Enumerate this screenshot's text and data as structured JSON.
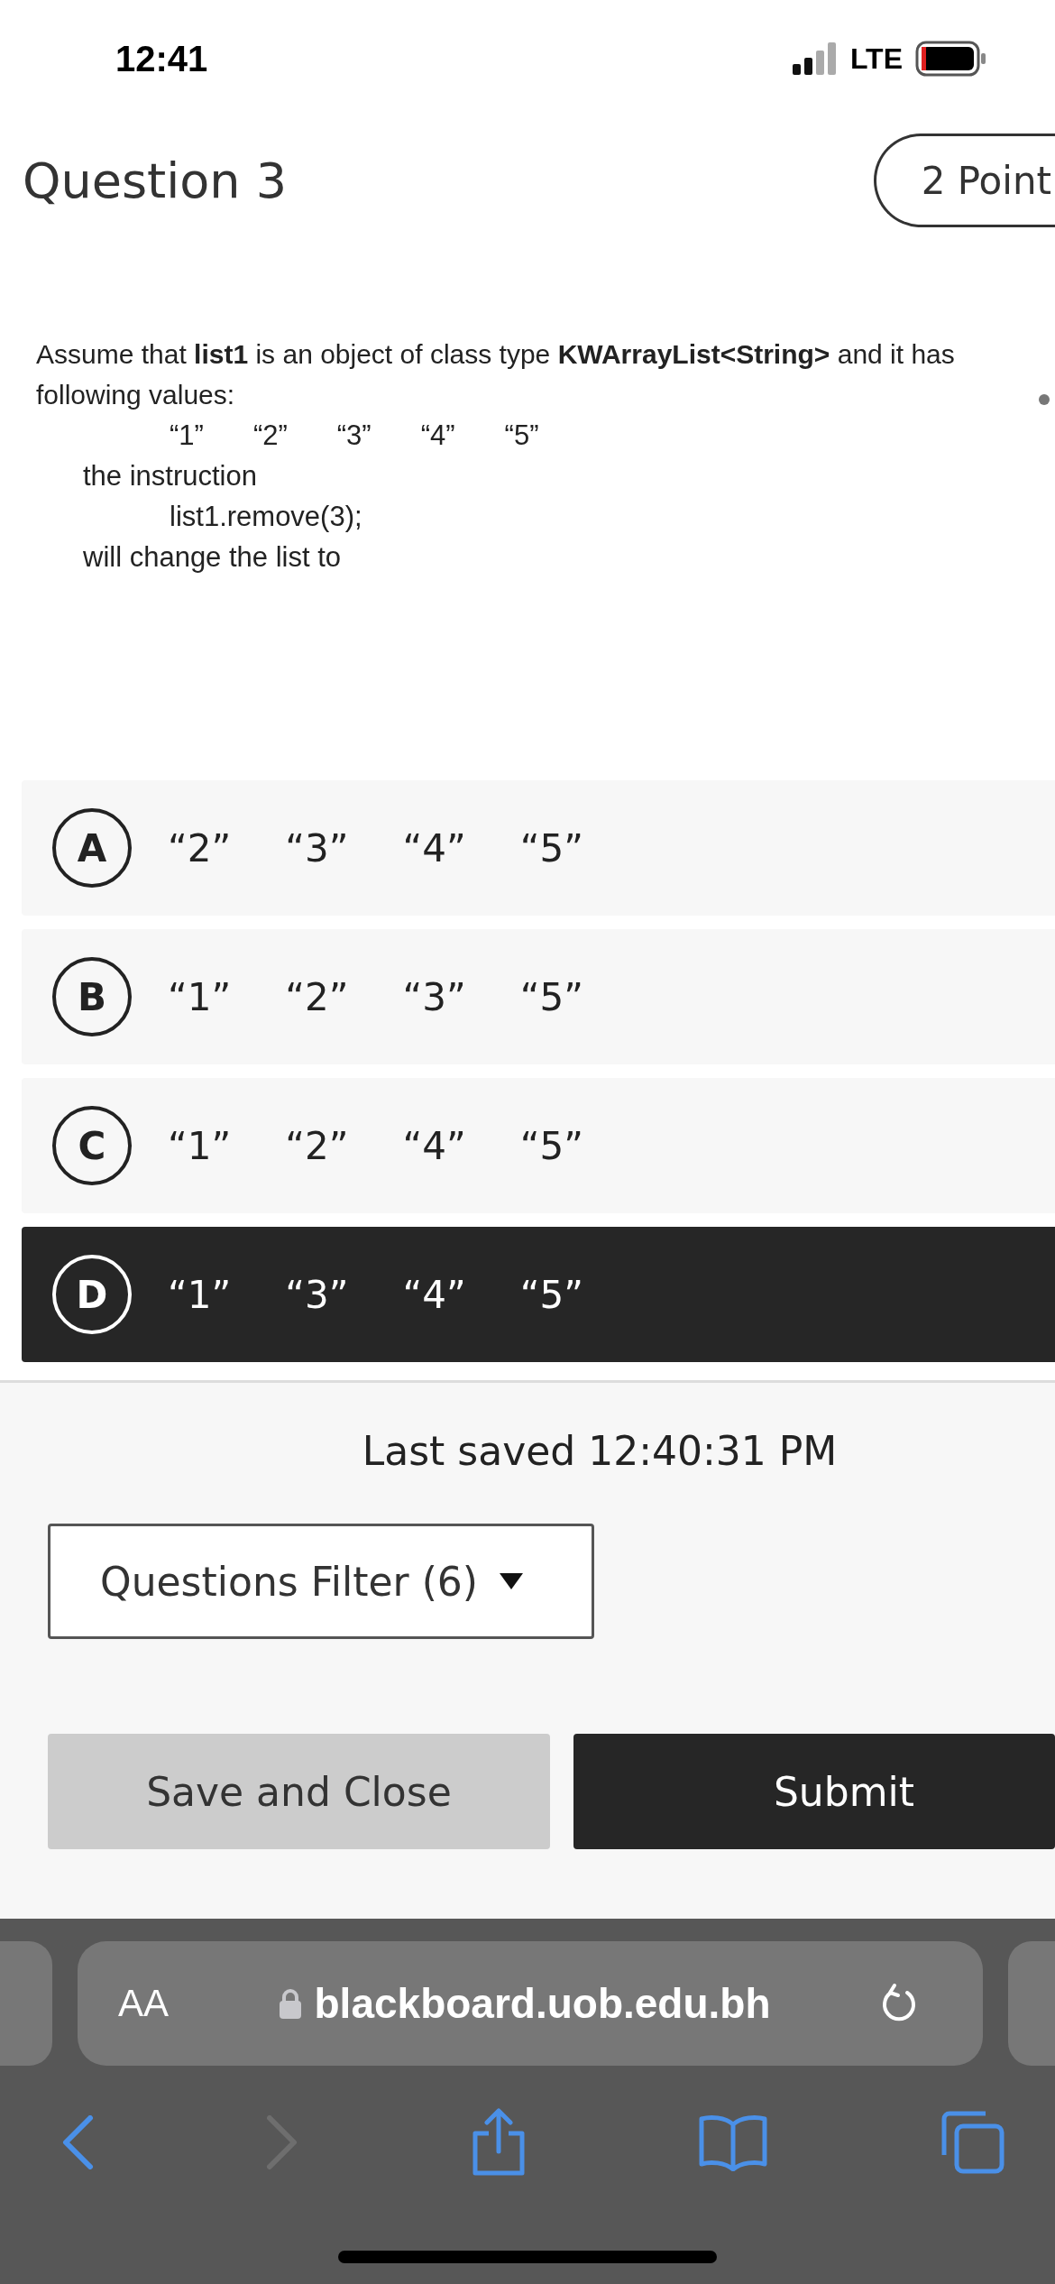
{
  "status_bar": {
    "time": "12:41",
    "network": "LTE"
  },
  "question": {
    "title": "Question 3",
    "points": "2 Point"
  },
  "prompt": {
    "intro": "Assume that **list1** is an object of class type **KWArrayList<String>** and it has\nfollowing values:",
    "values": [
      "“1”",
      "“2”",
      "“3”",
      "“4”",
      "“5”"
    ],
    "line_1": "the instruction",
    "code": "list1.remove(3);",
    "line_2": "will change the list to"
  },
  "options": [
    {
      "letter": "A",
      "values": [
        "“2”",
        "“3”",
        "“4”",
        "“5”"
      ],
      "selected": false
    },
    {
      "letter": "B",
      "values": [
        "“1”",
        "“2”",
        "“3”",
        "“5”"
      ],
      "selected": false
    },
    {
      "letter": "C",
      "values": [
        "“1”",
        "“2”",
        "“4”",
        "“5”"
      ],
      "selected": false
    },
    {
      "letter": "D",
      "values": [
        "“1”",
        "“3”",
        "“4”",
        "“5”"
      ],
      "selected": true
    }
  ],
  "last_saved": "Last saved 12:40:31 PM",
  "filter": {
    "label": "Questions Filter (6)"
  },
  "buttons": [
    {
      "label": "Save and Close",
      "kind": "secondary"
    },
    {
      "label": "Submit",
      "kind": "primary"
    }
  ],
  "browser": {
    "text_size": "AA",
    "url": "blackboard.uob.edu.bh"
  }
}
